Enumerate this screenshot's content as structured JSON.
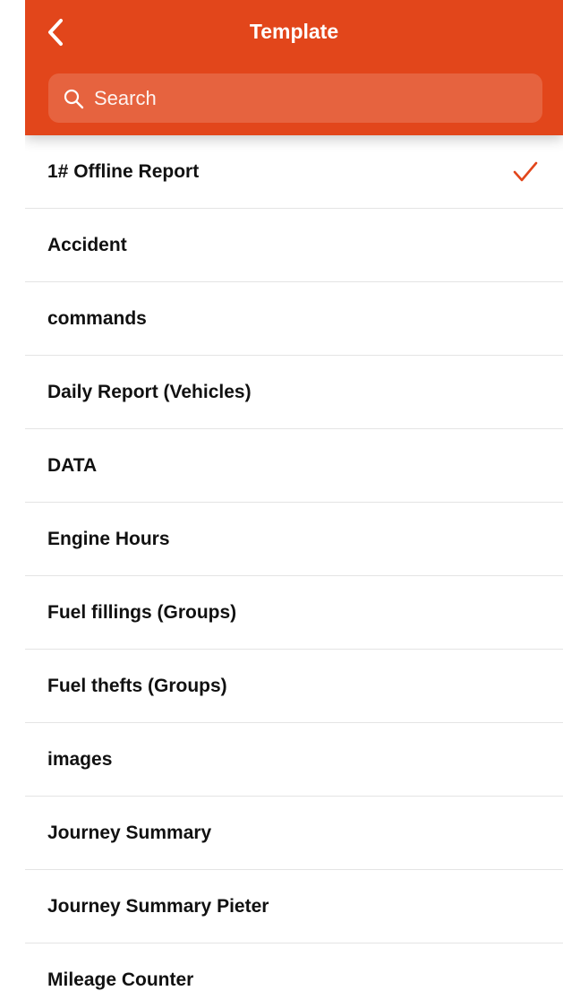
{
  "colors": {
    "accent": "#e2461b",
    "checkmark": "#e2461b"
  },
  "header": {
    "title": "Template",
    "back_icon": "chevron-left-icon"
  },
  "search": {
    "placeholder": "Search",
    "value": "",
    "icon": "search-icon"
  },
  "templates": {
    "selected_index": 0,
    "items": [
      {
        "label": "1# Offline Report"
      },
      {
        "label": "Accident"
      },
      {
        "label": "commands"
      },
      {
        "label": "Daily Report (Vehicles)"
      },
      {
        "label": "DATA"
      },
      {
        "label": "Engine Hours"
      },
      {
        "label": "Fuel fillings (Groups)"
      },
      {
        "label": "Fuel thefts (Groups)"
      },
      {
        "label": "images"
      },
      {
        "label": "Journey Summary"
      },
      {
        "label": "Journey Summary Pieter"
      },
      {
        "label": "Mileage Counter"
      }
    ]
  }
}
